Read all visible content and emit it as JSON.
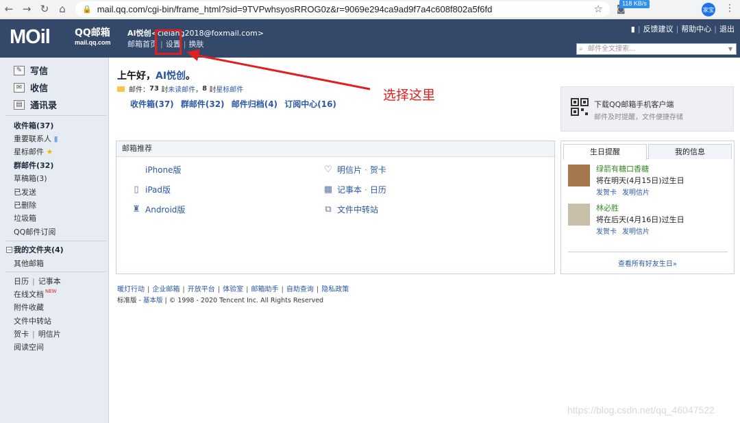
{
  "browser": {
    "url": "mail.qq.com/cgi-bin/frame_html?sid=9TVPwhsyosRROG0z&r=9069e294ca9ad9f7a4c608f802a5f6fd",
    "speed": "118 KB/s",
    "user_chip": "家宝"
  },
  "header": {
    "logo_main": "MOil",
    "logo_cn": "QQ邮箱",
    "logo_domain": "mail.qq.com",
    "account_name": "AI悦创",
    "account_email": "<clelang2018@foxmail.com>",
    "links": [
      "邮箱首页",
      "设置",
      "换肤"
    ],
    "top_right": [
      "反馈建议",
      "帮助中心",
      "退出"
    ],
    "search_placeholder": "邮件全文搜索..."
  },
  "annotation": {
    "text": "选择这里",
    "color": "#e02020"
  },
  "sidebar": {
    "compose": "写信",
    "inbox_check": "收信",
    "contacts": "通讯录",
    "folders": [
      {
        "label": "收件箱(37)",
        "bold": true
      },
      {
        "label": "重要联系人",
        "bold": false
      },
      {
        "label": "星标邮件",
        "bold": false
      },
      {
        "label": "群邮件(32)",
        "bold": true
      },
      {
        "label": "草稿箱(3)",
        "bold": false
      },
      {
        "label": "已发送",
        "bold": false
      },
      {
        "label": "已删除",
        "bold": false
      },
      {
        "label": "垃圾箱",
        "bold": false
      },
      {
        "label": "QQ邮件订阅",
        "bold": false
      }
    ],
    "my_folders": "我的文件夹(4)",
    "other_mail": "其他邮箱",
    "tools": {
      "calendar": "日历",
      "notebook": "记事本",
      "online_docs": "在线文档",
      "new_badge": "NEW",
      "attachments": "附件收藏",
      "file_transfer": "文件中转站",
      "greeting_card": "贺卡",
      "postcard": "明信片",
      "reading": "阅读空间"
    }
  },
  "main": {
    "greeting_prefix": "上午好，",
    "greeting_name": "AI悦创",
    "greeting_suffix": "。",
    "mail_label": "邮件：",
    "unread_count": "73",
    "unread_text": "封",
    "unread_link": "未读邮件",
    "starred_count": "8",
    "starred_text": "封",
    "starred_link": "星标邮件",
    "quick_links": [
      "收件箱(37)",
      "群邮件(32)",
      "邮件归档(4)",
      "订阅中心(16)"
    ],
    "mobile": {
      "title": "下载QQ邮箱手机客户端",
      "subtitle": "邮件及时提醒，文件便捷存储"
    },
    "recommend": {
      "header": "邮箱推荐",
      "iphone": "iPhone版",
      "ipad": "iPad版",
      "android": "Android版",
      "postcard": "明信片",
      "greeting": "贺卡",
      "notebook": "记事本",
      "calendar": "日历",
      "transfer": "文件中转站",
      "dot": "·"
    },
    "birthday": {
      "tab_birthday": "生日提醒",
      "tab_info": "我的信息",
      "people": [
        {
          "name": "绿箭有糖口香糖",
          "date": "将在明天(4月15日)过生日",
          "card": "发贺卡",
          "postcard": "发明信片"
        },
        {
          "name": "林必胜",
          "date": "将在后天(4月16日)过生日",
          "card": "发贺卡",
          "postcard": "发明信片"
        }
      ],
      "view_all": "查看所有好友生日»"
    }
  },
  "footer": {
    "links": [
      "暖灯行动",
      "企业邮箱",
      "开放平台",
      "体验室",
      "邮箱助手",
      "自助查询",
      "隐私政策"
    ],
    "version_label": "标准版",
    "basic_version": "基本版",
    "copyright": "© 1998 - 2020 Tencent Inc. All Rights Reserved"
  },
  "watermark": "https://blog.csdn.net/qq_46047522"
}
